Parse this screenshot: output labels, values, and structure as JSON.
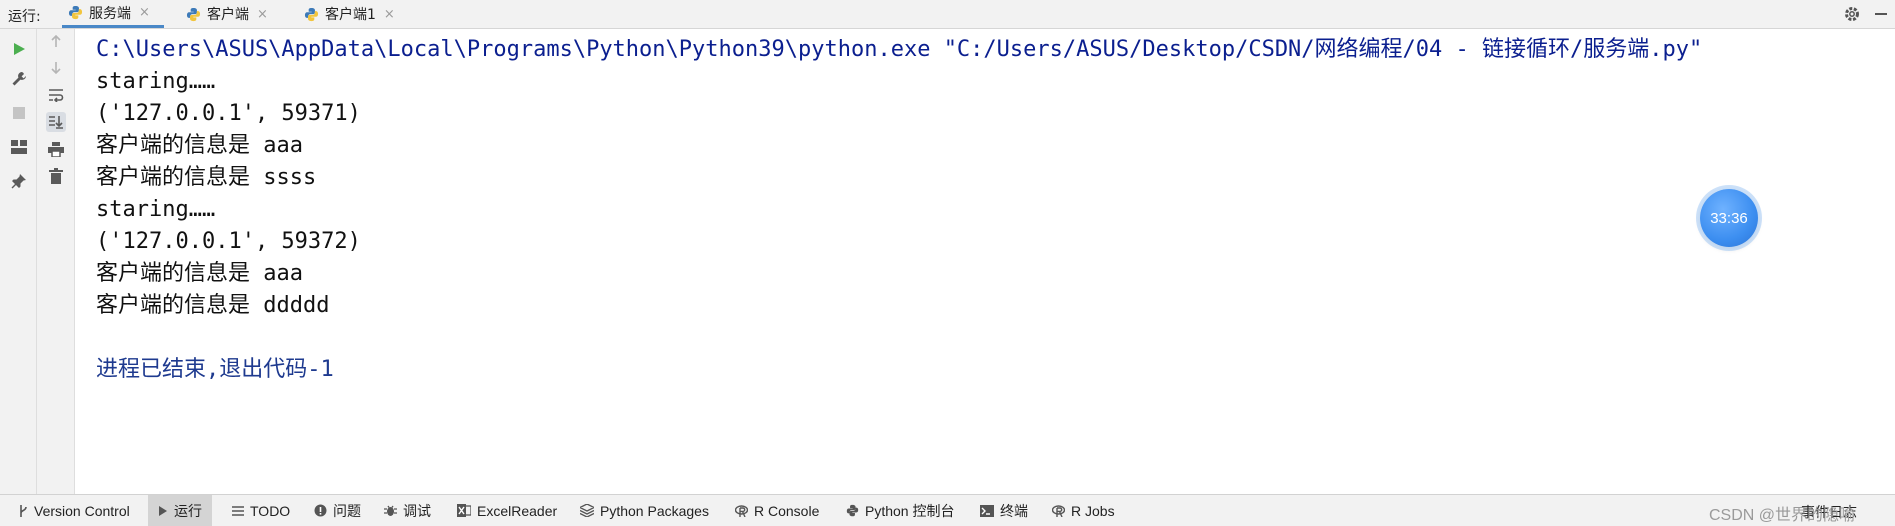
{
  "run_panel": {
    "label": "运行:",
    "tabs": [
      {
        "label": "服务端",
        "icon": "python-icon",
        "active": true
      },
      {
        "label": "客户端",
        "icon": "python-icon",
        "active": false
      },
      {
        "label": "客户端1",
        "icon": "python-icon",
        "active": false
      }
    ],
    "close_glyph": "×"
  },
  "console": {
    "lines": [
      {
        "kind": "cmd",
        "text": "C:\\Users\\ASUS\\AppData\\Local\\Programs\\Python\\Python39\\python.exe \"C:/Users/ASUS/Desktop/CSDN/网络编程/04 - 链接循环/服务端.py\""
      },
      {
        "kind": "out",
        "text": "staring……"
      },
      {
        "kind": "out",
        "text": "('127.0.0.1', 59371)"
      },
      {
        "kind": "out",
        "text": "客户端的信息是 aaa"
      },
      {
        "kind": "out",
        "text": "客户端的信息是 ssss"
      },
      {
        "kind": "out",
        "text": "staring……"
      },
      {
        "kind": "out",
        "text": "('127.0.0.1', 59372)"
      },
      {
        "kind": "out",
        "text": "客户端的信息是 aaa"
      },
      {
        "kind": "out",
        "text": "客户端的信息是 ddddd"
      },
      {
        "kind": "blank",
        "text": ""
      },
      {
        "kind": "exit",
        "text": "进程已结束,退出代码-1"
      }
    ]
  },
  "timer": {
    "text": "33:36"
  },
  "bottom_bar": {
    "tabs": [
      {
        "label": "Version Control",
        "icon": "branch-icon"
      },
      {
        "label": "运行",
        "icon": "run-icon",
        "active": true
      },
      {
        "label": "TODO",
        "icon": "list-icon"
      },
      {
        "label": "问题",
        "icon": "info-icon"
      },
      {
        "label": "调试",
        "icon": "bug-icon"
      },
      {
        "label": "ExcelReader",
        "icon": "excel-icon"
      },
      {
        "label": "Python Packages",
        "icon": "packages-icon"
      },
      {
        "label": "R Console",
        "icon": "r-icon"
      },
      {
        "label": "Python 控制台",
        "icon": "python-console-icon"
      },
      {
        "label": "终端",
        "icon": "terminal-icon"
      },
      {
        "label": "R Jobs",
        "icon": "r-jobs-icon"
      }
    ],
    "event_log": "事件日志",
    "watermark": "CSDN @世界的隐喻"
  },
  "colors": {
    "command": "#0b1f8f",
    "output": "#111111",
    "exit": "#1e3a8f",
    "run_green": "#4caf50",
    "active_tab_underline": "#4a88c7",
    "timer_blue": "#3c8ef0"
  }
}
